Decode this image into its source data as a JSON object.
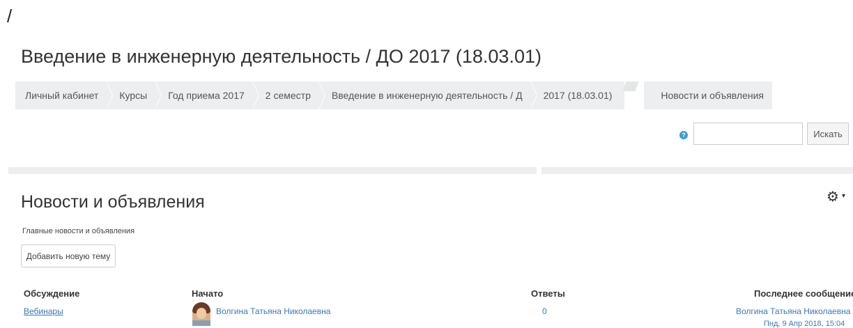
{
  "top_symbol": "/",
  "course_title": "Введение в инженерную деятельность / ДО 2017 (18.03.01)",
  "breadcrumb": {
    "items": [
      {
        "label": "Личный кабинет"
      },
      {
        "label": "Курсы"
      },
      {
        "label": "Год приема 2017"
      },
      {
        "label": "2 семестр"
      },
      {
        "label": "Введение в инженерную деятельность / Д"
      },
      {
        "label": "2017 (18.03.01)"
      },
      {
        "label": "Новости и объявления"
      }
    ]
  },
  "search": {
    "help_icon": "?",
    "placeholder": "",
    "button_label": "Искать"
  },
  "forum": {
    "title": "Новости и объявления",
    "intro": "Главные новости и объявления",
    "gear_icon": "⚙",
    "caret_icon": "▾",
    "add_topic_label": "Добавить новую тему"
  },
  "table": {
    "headers": [
      "Обсуждение",
      "Начато",
      "Ответы",
      "Последнее сообщение"
    ],
    "rows": [
      {
        "discussion": "Вебинары",
        "started_by": "Волгина Татьяна Николаевна",
        "replies": "0",
        "last_post_author": "Волгина Татьяна Николаевна",
        "last_post_date": "Пнд, 9 Апр 2018, 15:04"
      }
    ]
  },
  "colors": {
    "link": "#3a78b8",
    "breadcrumb_bg": "#eceeef",
    "help_icon": "#3a9bd6"
  }
}
